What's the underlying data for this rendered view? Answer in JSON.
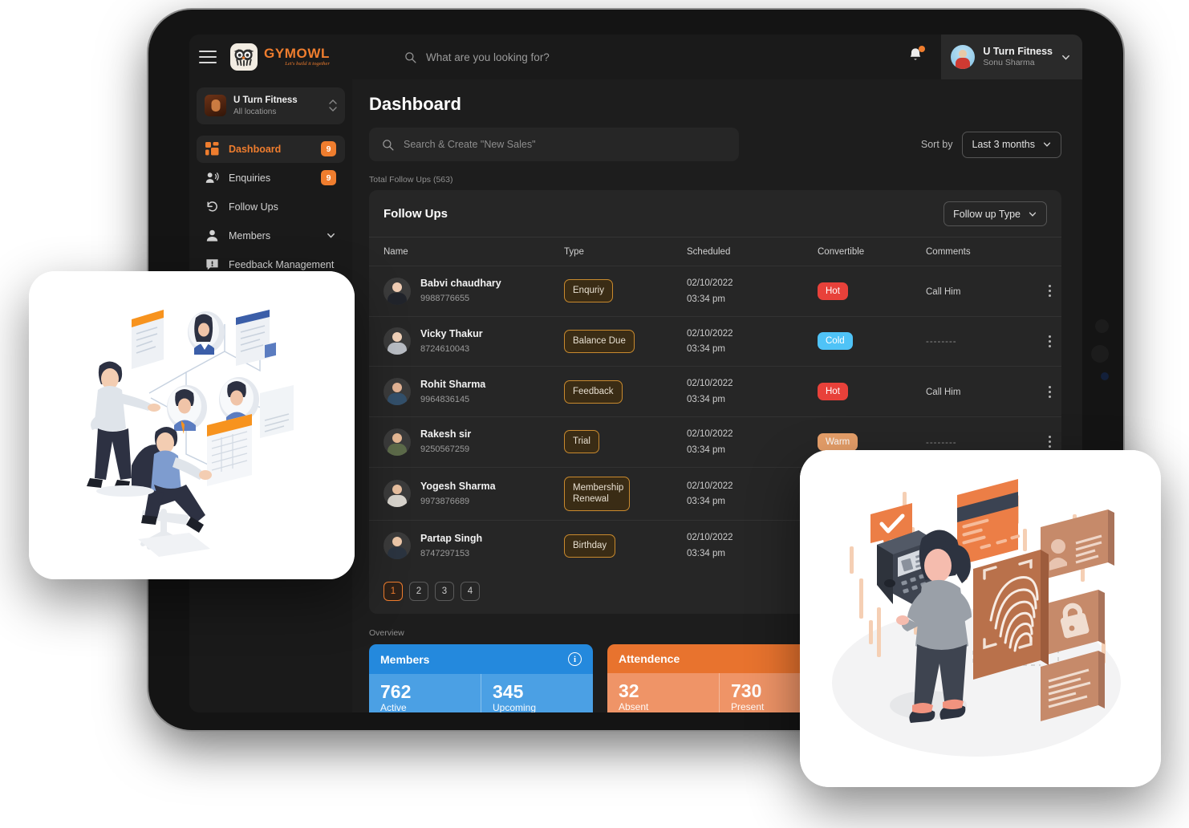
{
  "topbar": {
    "menu_icon": "hamburger-icon",
    "logo_name": "GYMOWL",
    "logo_tagline": "Let's build it together",
    "search_placeholder": "What are you looking for?",
    "search_icon": "search-icon",
    "bell_icon": "notification-bell-icon",
    "profile_name": "U Turn Fitness",
    "profile_user": "Sonu Sharma",
    "profile_chevron": "chevron-down-icon"
  },
  "sidebar": {
    "gym_name": "U Turn Fitness",
    "gym_location": "All locations",
    "switch_icon": "chevron-up-down-icon",
    "items": [
      {
        "label": "Dashboard",
        "icon": "grid-dashboard-icon",
        "badge": "9",
        "active": true,
        "chevron": ""
      },
      {
        "label": "Enquiries",
        "icon": "person-speaking-icon",
        "badge": "9",
        "active": false,
        "chevron": ""
      },
      {
        "label": "Follow Ups",
        "icon": "refresh-back-icon",
        "badge": "",
        "active": false,
        "chevron": ""
      },
      {
        "label": "Members",
        "icon": "person-icon",
        "badge": "",
        "active": false,
        "chevron": "chevron-down-icon"
      },
      {
        "label": "Feedback Management",
        "icon": "feedback-alert-icon",
        "badge": "",
        "active": false,
        "chevron": ""
      }
    ]
  },
  "main": {
    "page_title": "Dashboard",
    "search_placeholder": "Search & Create \"New Sales\"",
    "search_icon": "search-icon",
    "sort_label": "Sort by",
    "sort_value": "Last 3 months",
    "total_label": "Total Follow Ups (563)",
    "panel_title": "Follow Ups",
    "panel_filter": "Follow up Type",
    "columns": [
      "Name",
      "Type",
      "Scheduled",
      "Convertible",
      "Comments"
    ],
    "rows": [
      {
        "name": "Babvi chaudhary",
        "phone": "9988776655",
        "type": "Enquriy",
        "date": "02/10/2022",
        "time": "03:34 pm",
        "convertible": "Hot",
        "convertible_color": "#e8413a",
        "comment": "Call Him",
        "avatar_skin": "#f0cdb4",
        "avatar_cloth": "#21242b"
      },
      {
        "name": "Vicky Thakur",
        "phone": "8724610043",
        "type": "Balance Due",
        "date": "02/10/2022",
        "time": "03:34 pm",
        "convertible": "Cold",
        "convertible_color": "#4fc3f7",
        "comment": "--------",
        "avatar_skin": "#f2d3ba",
        "avatar_cloth": "#b9bdc4"
      },
      {
        "name": "Rohit Sharma",
        "phone": "9964836145",
        "type": "Feedback",
        "date": "02/10/2022",
        "time": "03:34 pm",
        "convertible": "Hot",
        "convertible_color": "#e8413a",
        "comment": "Call Him",
        "avatar_skin": "#e3b495",
        "avatar_cloth": "#33506b"
      },
      {
        "name": "Rakesh sir",
        "phone": "9250567259",
        "type": "Trial",
        "date": "02/10/2022",
        "time": "03:34 pm",
        "convertible": "Warm",
        "convertible_color": "#e8a06a",
        "comment": "--------",
        "avatar_skin": "#e6b894",
        "avatar_cloth": "#5d6b4a"
      },
      {
        "name": "Yogesh Sharma",
        "phone": "9973876689",
        "type": "Membership Renewal",
        "date": "02/10/2022",
        "time": "03:34 pm",
        "convertible": "",
        "convertible_color": "",
        "comment": "",
        "avatar_skin": "#e9c0a0",
        "avatar_cloth": "#d8d4cd"
      },
      {
        "name": "Partap Singh",
        "phone": "8747297153",
        "type": "Birthday",
        "date": "02/10/2022",
        "time": "03:34 pm",
        "convertible": "",
        "convertible_color": "",
        "comment": "",
        "avatar_skin": "#edc8a9",
        "avatar_cloth": "#2b3440"
      }
    ],
    "pages": [
      "1",
      "2",
      "3",
      "4"
    ],
    "overview_label": "Overview",
    "cards": [
      {
        "title": "Members",
        "info_icon": "info-icon",
        "cells": [
          {
            "value": "762",
            "label": "Active"
          },
          {
            "value": "345",
            "label": "Upcoming"
          }
        ]
      },
      {
        "title": "Attendence",
        "info_icon": "",
        "cells": [
          {
            "value": "32",
            "label": "Absent"
          },
          {
            "value": "730",
            "label": "Present"
          }
        ]
      }
    ]
  },
  "illustrations": {
    "left": "isometric-org-chart-team-illustration",
    "right": "isometric-biometric-attendance-illustration"
  },
  "colors": {
    "accent": "#ef7d2e",
    "hot": "#e8413a",
    "cold": "#4fc3f7",
    "warm": "#e8a06a",
    "members_card": "#2489dd",
    "attendance_card": "#e8732e"
  }
}
